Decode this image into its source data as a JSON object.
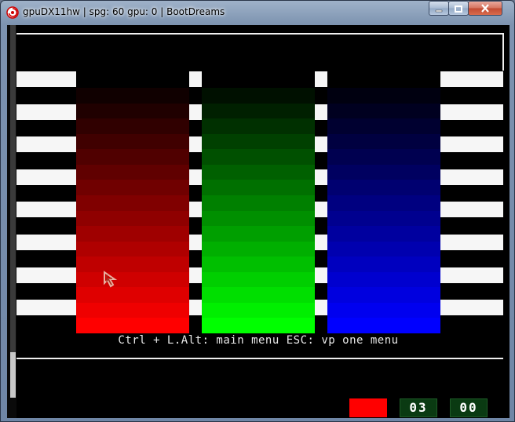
{
  "window": {
    "title": "gpuDX11hw | spg: 60 gpu: 0 | BootDreams",
    "minimize_icon": "minimize-icon",
    "maximize_icon": "maximize-icon",
    "close_icon": "close-icon"
  },
  "screen": {
    "message": "Ctrl + L.Alt: main menu  ESC: vp one menu",
    "bars": [
      {
        "name": "red",
        "color": "#ff0000"
      },
      {
        "name": "green",
        "color": "#00ff00"
      },
      {
        "name": "blue",
        "color": "#0000ff"
      }
    ],
    "status": {
      "color_swatch": "#ff0000",
      "counter_a": "03",
      "counter_b": "00"
    }
  }
}
